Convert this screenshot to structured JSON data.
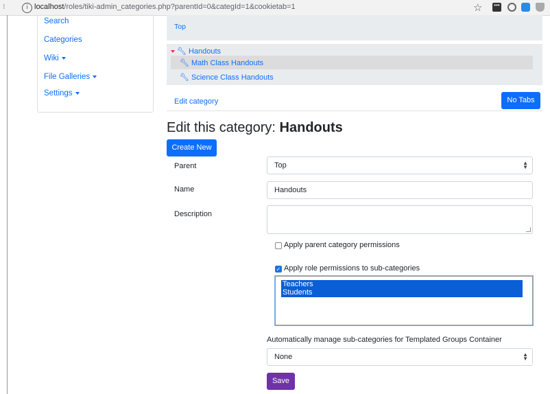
{
  "browser": {
    "url_host": "localhost",
    "url_path": "/roles/tiki-admin_categories.php?parentId=0&categId=1&cookietab=1"
  },
  "sidebar": {
    "items": [
      {
        "label": "Search"
      },
      {
        "label": "Categories"
      },
      {
        "label": "Wiki"
      },
      {
        "label": "File Galleries"
      },
      {
        "label": "Settings"
      }
    ]
  },
  "breadcrumb": {
    "top": "Top"
  },
  "tree": {
    "root": "Handouts",
    "children": [
      "Math Class Handouts",
      "Science Class Handouts"
    ]
  },
  "tabs": {
    "edit_category": "Edit category",
    "no_tabs": "No Tabs"
  },
  "form": {
    "title_prefix": "Edit this category:",
    "title_name": "Handouts",
    "create_new": "Create New",
    "parent_label": "Parent",
    "parent_value": "Top",
    "name_label": "Name",
    "name_value": "Handouts",
    "description_label": "Description",
    "description_value": "",
    "apply_parent_perms": "Apply parent category permissions",
    "apply_parent_perms_checked": false,
    "apply_role_perms": "Apply role permissions to sub-categories",
    "apply_role_perms_checked": true,
    "roles": [
      "Teachers",
      "Students"
    ],
    "auto_manage_label": "Automatically manage sub-categories for Templated Groups Container",
    "auto_manage_value": "None",
    "save": "Save"
  },
  "colors": {
    "primary": "#0d6efd",
    "save": "#6f32a8",
    "selected_option": "#0a5fd6",
    "panel_bg": "#e9ecef"
  }
}
